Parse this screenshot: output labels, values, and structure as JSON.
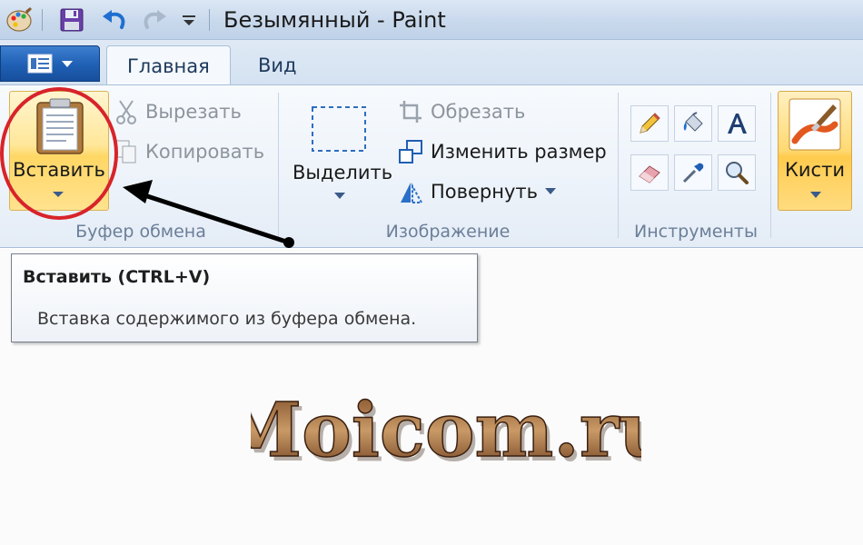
{
  "window": {
    "title": "Безымянный - Paint"
  },
  "quick_access": [
    "paint-logo-icon",
    "save-icon",
    "undo-icon",
    "redo-icon",
    "customize-dropdown-icon"
  ],
  "tabs": [
    {
      "label": "Главная",
      "active": true
    },
    {
      "label": "Вид",
      "active": false
    }
  ],
  "clipboard": {
    "paste_label": "Вставить",
    "cut_label": "Вырезать",
    "copy_label": "Копировать",
    "group_label": "Буфер обмена"
  },
  "image": {
    "select_label": "Выделить",
    "crop_label": "Обрезать",
    "resize_label": "Изменить размер",
    "rotate_label": "Повернуть",
    "group_label": "Изображение"
  },
  "tools": {
    "items": [
      "pencil-icon",
      "fill-icon",
      "text-icon",
      "eraser-icon",
      "color-picker-icon",
      "magnifier-icon"
    ],
    "group_label": "Инструменты"
  },
  "brushes": {
    "label": "Кисти"
  },
  "tooltip": {
    "title": "Вставить (CTRL+V)",
    "description": "Вставка содержимого из буфера обмена."
  },
  "watermark": {
    "text": "Moicom.ru"
  },
  "colors": {
    "highlight_circle": "#d8232a",
    "active_button": "#ffd765",
    "app_menu": "#1f5fb4"
  }
}
